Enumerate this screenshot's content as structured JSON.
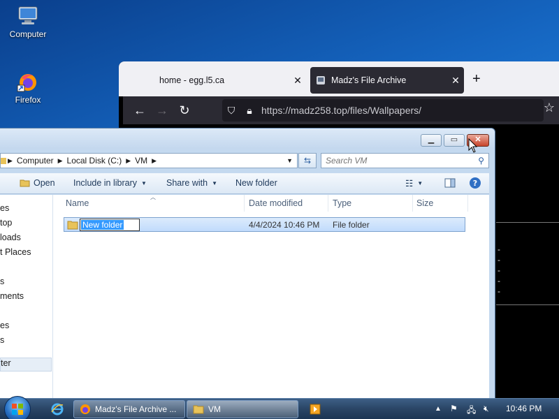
{
  "desktop": {
    "icons": [
      {
        "label": "Computer",
        "icon": "computer-icon"
      },
      {
        "label": "Firefox",
        "icon": "firefox-icon"
      }
    ]
  },
  "browser": {
    "tabs": [
      {
        "label": "home - egg.l5.ca",
        "active": false
      },
      {
        "label": "Madz's File Archive",
        "active": true
      }
    ],
    "url": "https://madz258.top/files/Wallpapers/",
    "new_tab": "+"
  },
  "explorer": {
    "breadcrumb": [
      "Computer",
      "Local Disk (C:)",
      "VM"
    ],
    "search_placeholder": "Search VM",
    "toolbar": {
      "open": "Open",
      "include": "Include in library",
      "share": "Share with",
      "new_folder": "New folder"
    },
    "nav_items": [
      "es",
      "top",
      "loads",
      "t Places",
      "s",
      "ments",
      "",
      "es",
      "s",
      "ter"
    ],
    "columns": [
      "Name",
      "Date modified",
      "Type",
      "Size"
    ],
    "rows": [
      {
        "name": "New folder",
        "date": "4/4/2024 10:46 PM",
        "type": "File folder",
        "size": ""
      }
    ]
  },
  "taskbar": {
    "tasks": [
      "Madz's File Archive ...",
      "VM"
    ],
    "clock": "10:46 PM"
  },
  "colors": {
    "explorer_frame": "#c4d9ef",
    "firefox_dark": "#2b2a33",
    "selection": "#3399ff"
  }
}
